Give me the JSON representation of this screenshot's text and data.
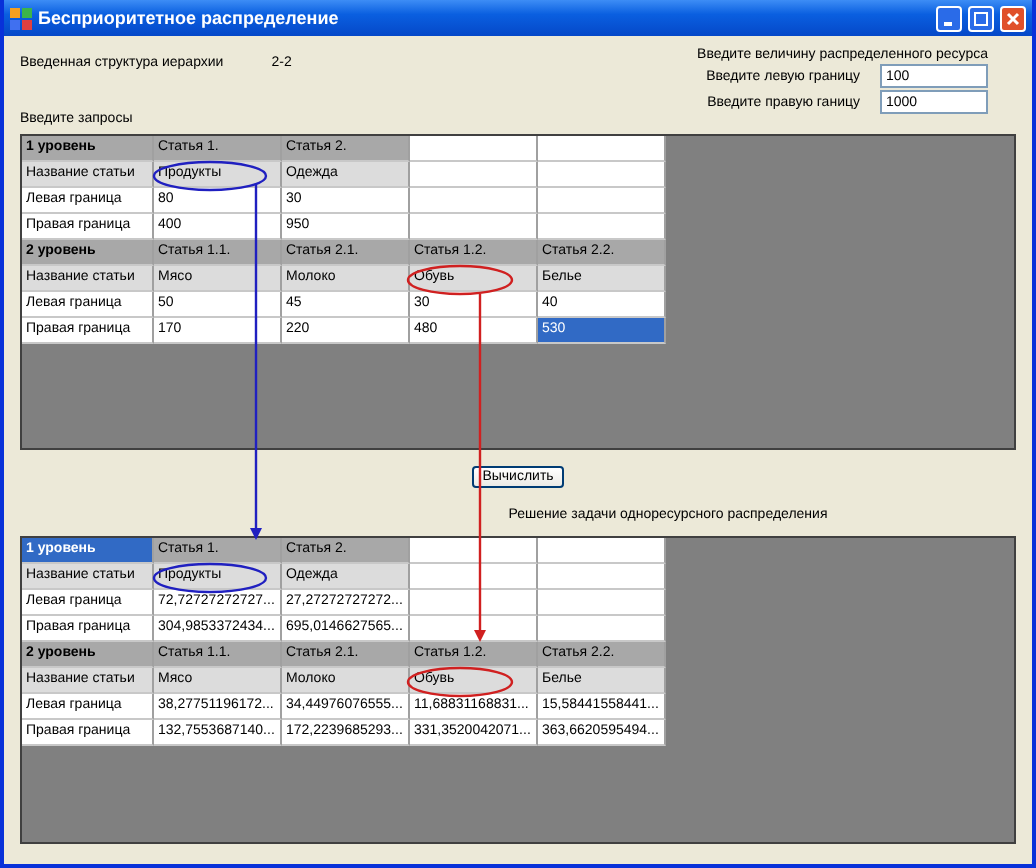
{
  "window": {
    "title": "Бесприоритетное распределение"
  },
  "hierarchy": {
    "label": "Введенная структура иерархии",
    "value": "2-2"
  },
  "resource": {
    "heading": "Введите величину распределенного ресурса",
    "fields": [
      {
        "label": "Введите левую границу",
        "value": "100"
      },
      {
        "label": "Введите правую ганицу",
        "value": "1000"
      }
    ]
  },
  "requests_label": "Введите запросы",
  "input_table": {
    "rows": [
      {
        "kind": "level",
        "cells": [
          {
            "text": "1 уровень",
            "selected": false
          },
          {
            "text": "Статья 1.",
            "selected": false
          },
          {
            "text": "Статья 2.",
            "selected": false
          }
        ]
      },
      {
        "kind": "names",
        "cells": [
          {
            "text": "Название статьи",
            "selected": false
          },
          {
            "text": "Продукты",
            "selected": false
          },
          {
            "text": "Одежда",
            "selected": false
          }
        ]
      },
      {
        "kind": "values",
        "cells": [
          {
            "text": "Левая граница",
            "selected": false
          },
          {
            "text": "80",
            "selected": false
          },
          {
            "text": "30",
            "selected": false
          }
        ]
      },
      {
        "kind": "values",
        "cells": [
          {
            "text": "Правая граница",
            "selected": false
          },
          {
            "text": "400",
            "selected": false
          },
          {
            "text": "950",
            "selected": false
          }
        ]
      },
      {
        "kind": "level",
        "cells": [
          {
            "text": "2 уровень",
            "selected": false
          },
          {
            "text": "Статья 1.1.",
            "selected": false
          },
          {
            "text": "Статья 2.1.",
            "selected": false
          },
          {
            "text": "Статья 1.2.",
            "selected": false
          },
          {
            "text": "Статья 2.2.",
            "selected": false
          }
        ]
      },
      {
        "kind": "names",
        "cells": [
          {
            "text": "Название статьи",
            "selected": false
          },
          {
            "text": "Мясо",
            "selected": false
          },
          {
            "text": "Молоко",
            "selected": false
          },
          {
            "text": "Обувь",
            "selected": false
          },
          {
            "text": "Белье",
            "selected": false
          }
        ]
      },
      {
        "kind": "values",
        "cells": [
          {
            "text": "Левая граница",
            "selected": false
          },
          {
            "text": "50",
            "selected": false
          },
          {
            "text": "45",
            "selected": false
          },
          {
            "text": "30",
            "selected": false
          },
          {
            "text": "40",
            "selected": false
          }
        ]
      },
      {
        "kind": "values",
        "cells": [
          {
            "text": "Правая граница",
            "selected": false
          },
          {
            "text": "170",
            "selected": false
          },
          {
            "text": "220",
            "selected": false
          },
          {
            "text": "480",
            "selected": false
          },
          {
            "text": "530",
            "selected": true
          }
        ]
      }
    ]
  },
  "compute_button": "Вычислить",
  "result_label": "Решение задачи одноресурсного распределения",
  "result_table": {
    "rows": [
      {
        "kind": "level",
        "cells": [
          {
            "text": "1 уровень",
            "selected": true
          },
          {
            "text": "Статья 1.",
            "selected": false
          },
          {
            "text": "Статья 2.",
            "selected": false
          }
        ]
      },
      {
        "kind": "names",
        "cells": [
          {
            "text": "Название статьи",
            "selected": false
          },
          {
            "text": "Продукты",
            "selected": false
          },
          {
            "text": "Одежда",
            "selected": false
          }
        ]
      },
      {
        "kind": "values",
        "cells": [
          {
            "text": "Левая граница",
            "selected": false
          },
          {
            "text": "72,72727272727...",
            "selected": false
          },
          {
            "text": "27,27272727272...",
            "selected": false
          }
        ]
      },
      {
        "kind": "values",
        "cells": [
          {
            "text": "Правая граница",
            "selected": false
          },
          {
            "text": "304,9853372434...",
            "selected": false
          },
          {
            "text": "695,0146627565...",
            "selected": false
          }
        ]
      },
      {
        "kind": "level",
        "cells": [
          {
            "text": "2 уровень",
            "selected": false
          },
          {
            "text": "Статья 1.1.",
            "selected": false
          },
          {
            "text": "Статья 2.1.",
            "selected": false
          },
          {
            "text": "Статья 1.2.",
            "selected": false
          },
          {
            "text": "Статья 2.2.",
            "selected": false
          }
        ]
      },
      {
        "kind": "names",
        "cells": [
          {
            "text": "Название статьи",
            "selected": false
          },
          {
            "text": "Мясо",
            "selected": false
          },
          {
            "text": "Молоко",
            "selected": false
          },
          {
            "text": "Обувь",
            "selected": false
          },
          {
            "text": "Белье",
            "selected": false
          }
        ]
      },
      {
        "kind": "values",
        "cells": [
          {
            "text": "Левая граница",
            "selected": false
          },
          {
            "text": "38,27751196172...",
            "selected": false
          },
          {
            "text": "34,44976076555...",
            "selected": false
          },
          {
            "text": "11,68831168831...",
            "selected": false
          },
          {
            "text": "15,58441558441...",
            "selected": false
          }
        ]
      },
      {
        "kind": "values",
        "cells": [
          {
            "text": "Правая граница",
            "selected": false
          },
          {
            "text": "132,7553687140...",
            "selected": false
          },
          {
            "text": "172,2239685293...",
            "selected": false
          },
          {
            "text": "331,3520042071...",
            "selected": false
          },
          {
            "text": "363,6620595494...",
            "selected": false
          }
        ]
      }
    ]
  }
}
